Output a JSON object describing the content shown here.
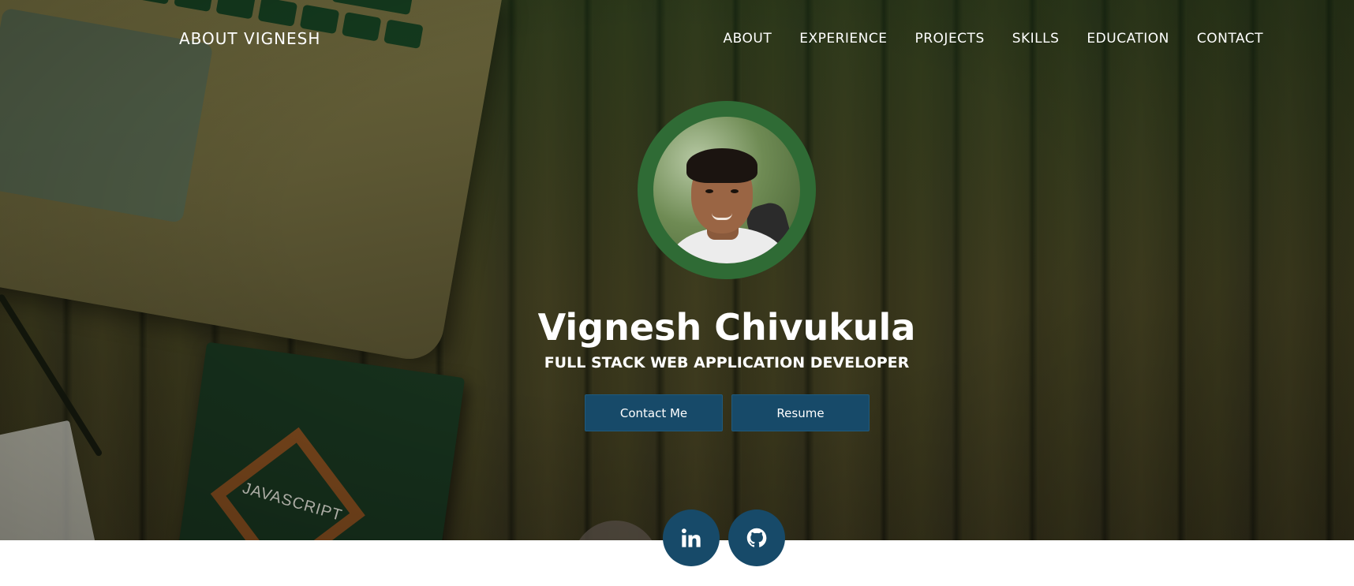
{
  "nav": {
    "brand": "ABOUT VIGNESH",
    "links": [
      {
        "label": "ABOUT"
      },
      {
        "label": "EXPERIENCE"
      },
      {
        "label": "PROJECTS"
      },
      {
        "label": "SKILLS"
      },
      {
        "label": "EDUCATION"
      },
      {
        "label": "CONTACT"
      }
    ]
  },
  "hero": {
    "name": "Vignesh Chivukula",
    "tagline": "FULL STACK WEB APPLICATION DEVELOPER",
    "background_book_text": "JAVASCRIPT",
    "buttons": {
      "contact_label": "Contact Me",
      "resume_label": "Resume"
    },
    "social": [
      {
        "icon": "linkedin-icon"
      },
      {
        "icon": "github-icon"
      }
    ]
  },
  "colors": {
    "accent": "#174a69",
    "avatar_ring": "#2f6b35",
    "text": "#ffffff"
  }
}
